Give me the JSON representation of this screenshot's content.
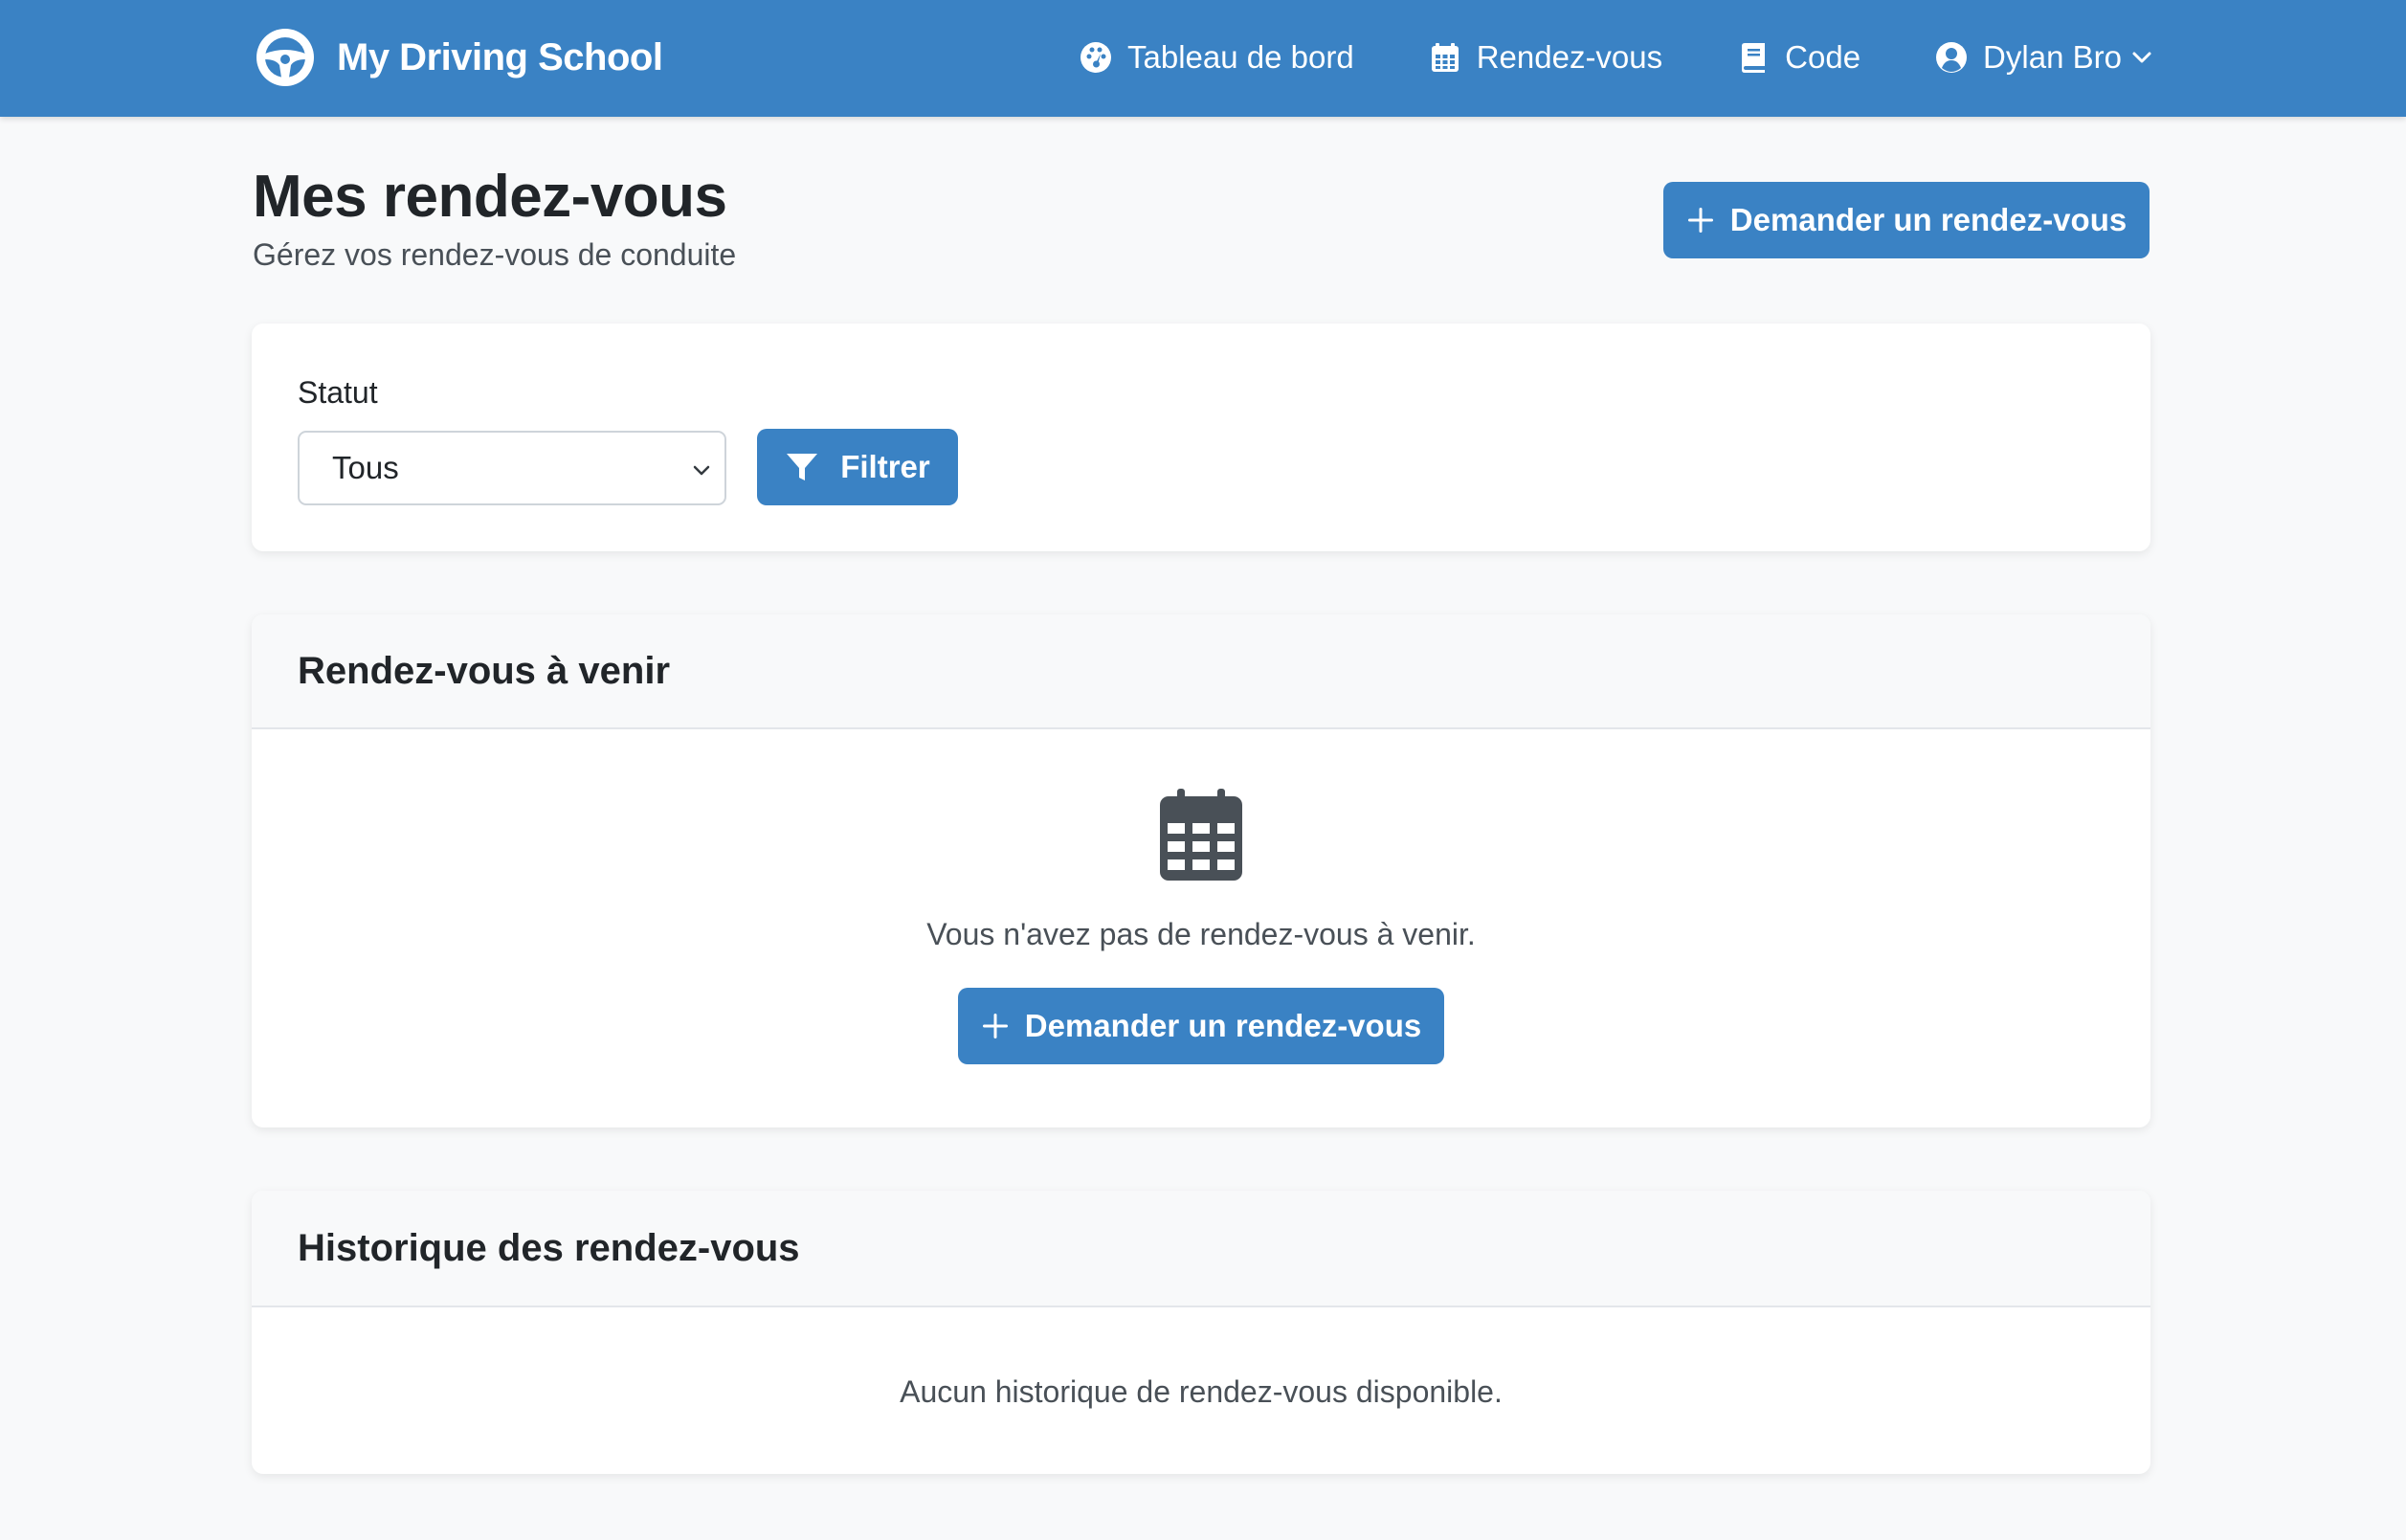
{
  "brand": {
    "name": "My Driving School",
    "icon": "steering-wheel-icon"
  },
  "nav": {
    "items": [
      {
        "label": "Tableau de bord",
        "icon": "dashboard-icon"
      },
      {
        "label": "Rendez-vous",
        "icon": "calendar-icon"
      },
      {
        "label": "Code",
        "icon": "book-icon"
      }
    ],
    "user": {
      "name": "Dylan Bro",
      "icon": "user-circle-icon"
    }
  },
  "header": {
    "title": "Mes rendez-vous",
    "subtitle": "Gérez vos rendez-vous de conduite",
    "request_button": "Demander un rendez-vous"
  },
  "filter": {
    "label": "Statut",
    "selected": "Tous",
    "button": "Filtrer"
  },
  "upcoming": {
    "title": "Rendez-vous à venir",
    "empty_text": "Vous n'avez pas de rendez-vous à venir.",
    "request_button": "Demander un rendez-vous"
  },
  "history": {
    "title": "Historique des rendez-vous",
    "empty_text": "Aucun historique de rendez-vous disponible."
  },
  "colors": {
    "primary": "#3a82c4",
    "background": "#f8f9fa",
    "text": "#212529",
    "muted": "#495057"
  }
}
